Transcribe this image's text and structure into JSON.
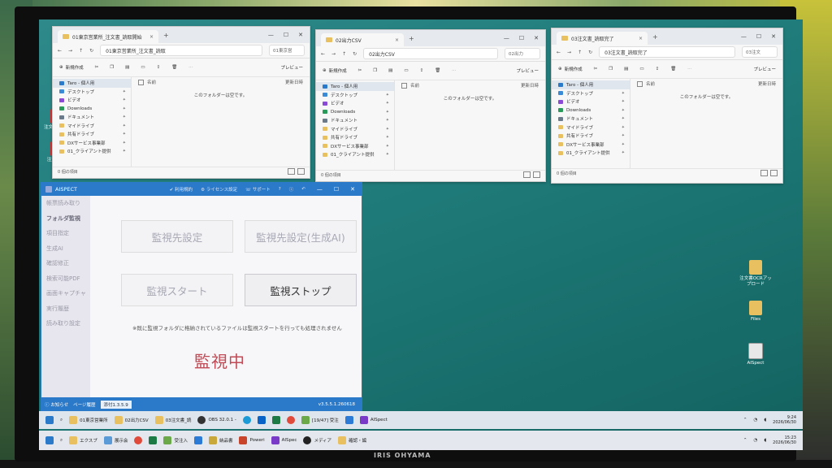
{
  "brand": "IRIS OHYAMA",
  "desktop_icons": [
    {
      "label": "注文書_テスト用PDF",
      "glyph": "pdf-icon"
    },
    {
      "label": "注文書OCR",
      "glyph": "pdf-icon"
    },
    {
      "label": "注文書OCRアップロード",
      "glyph": "folder-icon"
    },
    {
      "label": "Files",
      "glyph": "folder-icon"
    },
    {
      "label": "AISpect",
      "glyph": "document-icon"
    }
  ],
  "explorers": [
    {
      "tab": "01東京営業所_注文書_読取開始",
      "address": "01東京営業所_注文書_読取",
      "search": "01東京営",
      "empty": "このフォルダーは空です。",
      "status": "0 個の項目"
    },
    {
      "tab": "02出力CSV",
      "address": "02出力CSV",
      "search": "02出力",
      "empty": "このフォルダーは空です。",
      "status": "0 個の項目"
    },
    {
      "tab": "03注文書_読取完了",
      "address": "03注文書_読取完了",
      "search": "03注文",
      "empty": "このフォルダーは空です。",
      "status": "0 個の項目"
    }
  ],
  "explorer_common": {
    "new": "新規作成",
    "preview": "プレビュー",
    "col_name": "名前",
    "col_updated": "更新日時",
    "nav": [
      "Taro - 個人用",
      "デスクトップ",
      "ビデオ",
      "Downloads",
      "ドキュメント",
      "マイドライブ",
      "共有ドライブ",
      "DXサービス事業部",
      "01_クライアント提供"
    ]
  },
  "app": {
    "title": "AISPECT",
    "toolbar": [
      "利用規約",
      "ライセンス設定",
      "サポート"
    ],
    "sidebar": [
      "帳票読み取り",
      "フォルダ監視",
      "項目指定",
      "生成AI",
      "確認修正",
      "検索可能PDF",
      "画面キャプチャ",
      "実行履歴",
      "読み取り設定"
    ],
    "active_index": 1,
    "btn_watch_target": "監視先設定",
    "btn_watch_target_ai": "監視先設定(生成AI)",
    "btn_start": "監視スタート",
    "btn_stop": "監視ストップ",
    "note": "※既に監視フォルダに格納されているファイルは監視スタートを行っても処理されません",
    "state": "監視中",
    "footer": [
      "お知らせ",
      "ページ履歴",
      "添付1.3.5.9"
    ],
    "version": "v3.5.5.1.260618"
  },
  "taskbar_inner": {
    "items": [
      "01東京営業所",
      "02出力CSV",
      "03注文書_読",
      "OBS 32.0.1 -",
      "[19/47] 受注",
      "AISpect"
    ],
    "time": "9:24",
    "date": "2026/06/30"
  },
  "taskbar_outer": {
    "items": [
      "エクスプ",
      "展示会",
      "受注入",
      "納品書",
      "Poweri",
      "AISpec",
      "メディア",
      "確認・編"
    ],
    "time": "15:23",
    "date": "2026/06/30"
  }
}
